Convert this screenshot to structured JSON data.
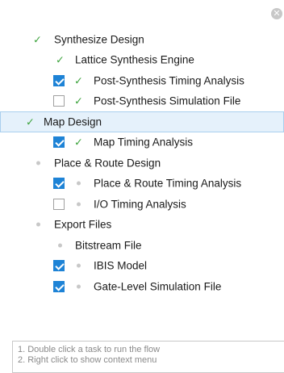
{
  "close_glyph": "✕",
  "tree": {
    "synth": {
      "label": "Synthesize Design",
      "status_icon": "check-icon"
    },
    "lse": {
      "label": "Lattice Synthesis Engine",
      "status_icon": "check-icon"
    },
    "post_synth_timing": {
      "label": "Post-Synthesis Timing Analysis",
      "checked": true,
      "status_icon": "check-icon"
    },
    "post_synth_sim": {
      "label": "Post-Synthesis Simulation File",
      "checked": false,
      "status_icon": "check-icon"
    },
    "map": {
      "label": "Map Design",
      "status_icon": "check-icon",
      "selected": true
    },
    "map_timing": {
      "label": "Map Timing Analysis",
      "checked": true,
      "status_icon": "check-icon"
    },
    "par": {
      "label": "Place & Route Design",
      "status_icon": "dot-icon"
    },
    "par_timing": {
      "label": "Place & Route Timing Analysis",
      "checked": true,
      "status_icon": "dot-icon"
    },
    "io_timing": {
      "label": "I/O Timing Analysis",
      "checked": false,
      "status_icon": "dot-icon"
    },
    "export": {
      "label": "Export Files",
      "status_icon": "dot-icon"
    },
    "bitstream": {
      "label": "Bitstream File",
      "status_icon": "dot-icon"
    },
    "ibis": {
      "label": "IBIS Model",
      "checked": true,
      "status_icon": "dot-icon"
    },
    "gate_sim": {
      "label": "Gate-Level Simulation File",
      "checked": true,
      "status_icon": "dot-icon"
    }
  },
  "hints": {
    "line1": "1. Double click a task to run the flow",
    "line2": "2. Right click to show context menu"
  },
  "colors": {
    "check": "#3ea43e",
    "checkbox_on": "#1e83d6",
    "dot": "#c8c8c8",
    "selected_bg": "#e5f1fb",
    "selected_border": "#a9cfee"
  }
}
